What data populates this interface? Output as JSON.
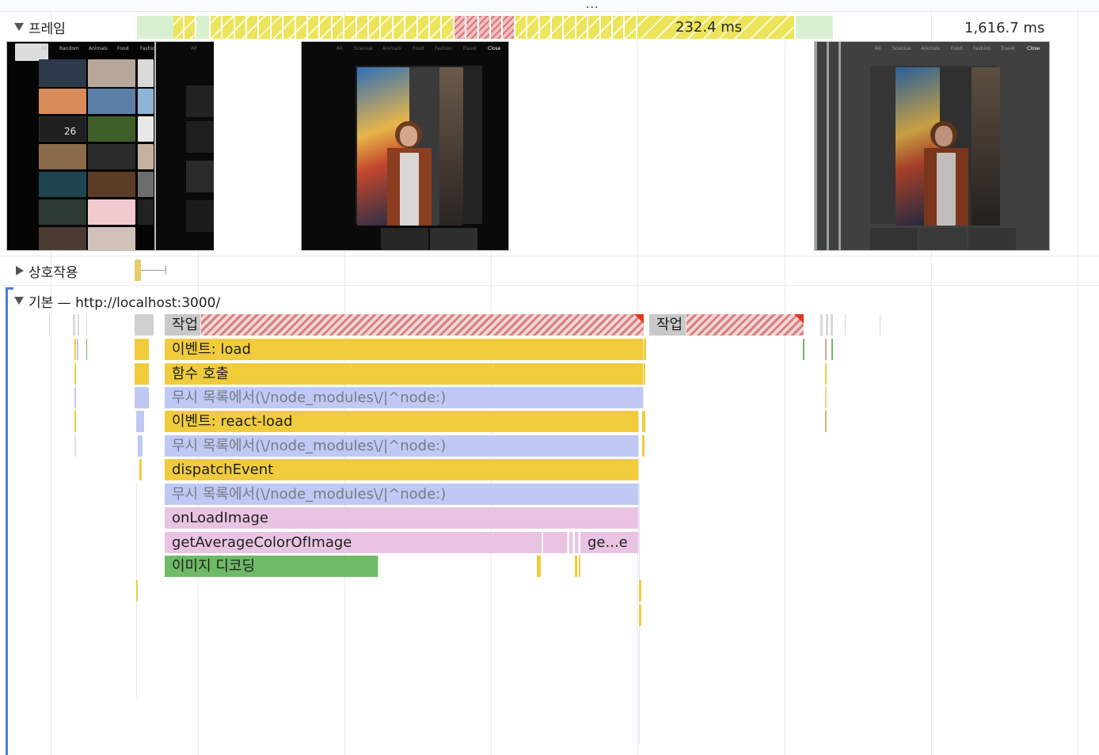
{
  "toolbar": {
    "more_label": "..."
  },
  "tracks": {
    "frames": {
      "label": "프레임",
      "duration_label": "232.4 ms",
      "end_label": "1,616.7 ms"
    },
    "interactions": {
      "label": "상호작용"
    },
    "main": {
      "label": "기본 — http://localhost:3000/"
    }
  },
  "screenshots": {
    "nav_left": [
      "All",
      "Random",
      "Animals",
      "Food",
      "Fashio"
    ],
    "nav_right": [
      "All",
      "Sceniue",
      "Animals",
      "Food",
      "Fashion",
      "Travel",
      "Close"
    ],
    "clock_text": "26"
  },
  "flame": {
    "task1": "작업",
    "task2": "작업",
    "event_load": "이벤트: load",
    "function_call": "함수 호출",
    "ignore_list_1": "무시 목록에서(\\/node_modules\\/|^node:)",
    "event_react_load": "이벤트: react-load",
    "ignore_list_2": "무시 목록에서(\\/node_modules\\/|^node:)",
    "dispatch_event": "dispatchEvent",
    "ignore_list_3": "무시 목록에서(\\/node_modules\\/|^node:)",
    "on_load_image": "onLoadImage",
    "get_average_color": "getAverageColorOfImage",
    "get_truncated": "ge...e",
    "image_decoding": "이미지 디코딩"
  },
  "colors": {
    "script_yellow": "#f0cc3c",
    "ignore_blue": "#bfc9f3",
    "function_pink": "#e8c4e2",
    "decode_green": "#6fba66",
    "task_grey": "#c9c9c9",
    "long_task_red": "#d97f7f",
    "track_accent": "#4a7fd8"
  },
  "icons": [
    "expand-triangle-down-icon",
    "collapse-triangle-right-icon",
    "more-dots-icon"
  ]
}
